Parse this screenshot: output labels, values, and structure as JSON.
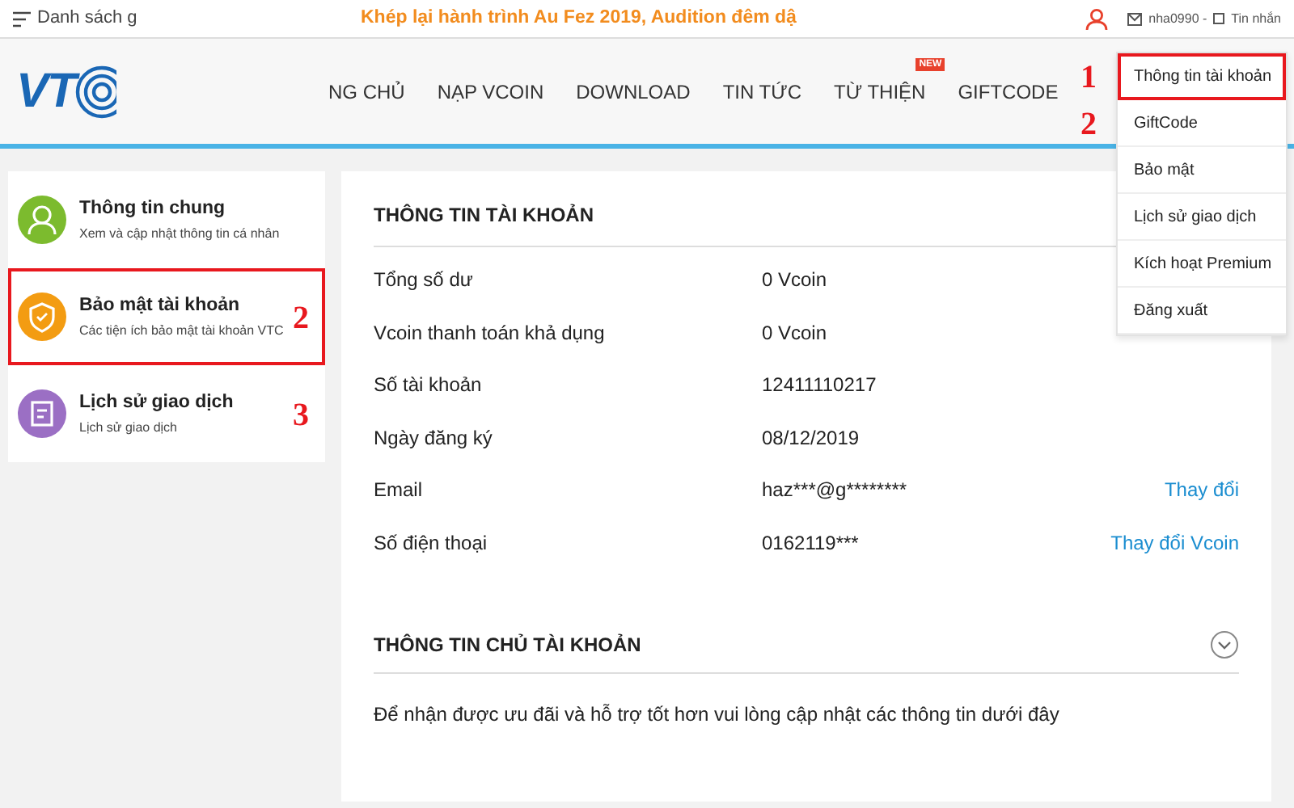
{
  "top_bar": {
    "menu_label": "Danh sách g",
    "announcement": "Khép lại hành trình Au Fez 2019, Audition đêm dậ",
    "username": "nha0990 -",
    "messages": "Tin nhắn"
  },
  "logo": {
    "text": "VT"
  },
  "nav": [
    {
      "label": "NG CHỦ"
    },
    {
      "label": "NẠP VCOIN"
    },
    {
      "label": "DOWNLOAD"
    },
    {
      "label": "TIN TỨC"
    },
    {
      "label": "TỪ THIỆN",
      "badge": "NEW"
    },
    {
      "label": "GIFTCODE"
    }
  ],
  "account_menu": [
    {
      "label": "Thông tin tài khoản",
      "highlighted": true,
      "annotation": "1"
    },
    {
      "label": "GiftCode",
      "highlighted": false,
      "annotation": "2"
    },
    {
      "label": "Bảo mật",
      "highlighted": false
    },
    {
      "label": "Lịch sử giao dịch",
      "highlighted": false
    },
    {
      "label": "Kích hoạt Premium",
      "highlighted": false
    },
    {
      "label": "Đăng xuất",
      "highlighted": false
    }
  ],
  "sidebar": [
    {
      "kind": "person",
      "title": "Thông tin chung",
      "subtitle": "Xem và cập nhật thông tin cá nhân",
      "color": "#7cbb2e",
      "highlighted": false
    },
    {
      "kind": "shield",
      "title": "Bảo mật tài khoản",
      "subtitle": "Các tiện ích bảo mật tài khoản VTC",
      "color": "#f39c12",
      "highlighted": true,
      "annotation": "2"
    },
    {
      "kind": "note",
      "title": "Lịch sử giao dịch",
      "subtitle": "Lịch sử giao dịch",
      "color": "#9b6fc4",
      "highlighted": false,
      "annotation": "3"
    }
  ],
  "account_info": {
    "title": "THÔNG TIN TÀI KHOẢN",
    "rows": [
      {
        "label": "Tổng số dư",
        "value": "0 Vcoin"
      },
      {
        "label": "Vcoin thanh toán khả dụng",
        "value": "0 Vcoin"
      },
      {
        "label": "Số tài khoản",
        "value": "12411110217"
      },
      {
        "label": "Ngày đăng ký",
        "value": "08/12/2019"
      },
      {
        "label": "Email",
        "value": "haz***@g********",
        "action": "Thay đổi"
      },
      {
        "label": "Số điện thoại",
        "value": "0162119***",
        "action": "Thay đổi Vcoin"
      }
    ]
  },
  "owner_info": {
    "title": "THÔNG TIN CHỦ TÀI KHOẢN",
    "expanded": false,
    "note": "Để nhận được ưu đãi và hỗ trợ tốt hơn vui lòng cập nhật các thông tin dưới đây"
  }
}
